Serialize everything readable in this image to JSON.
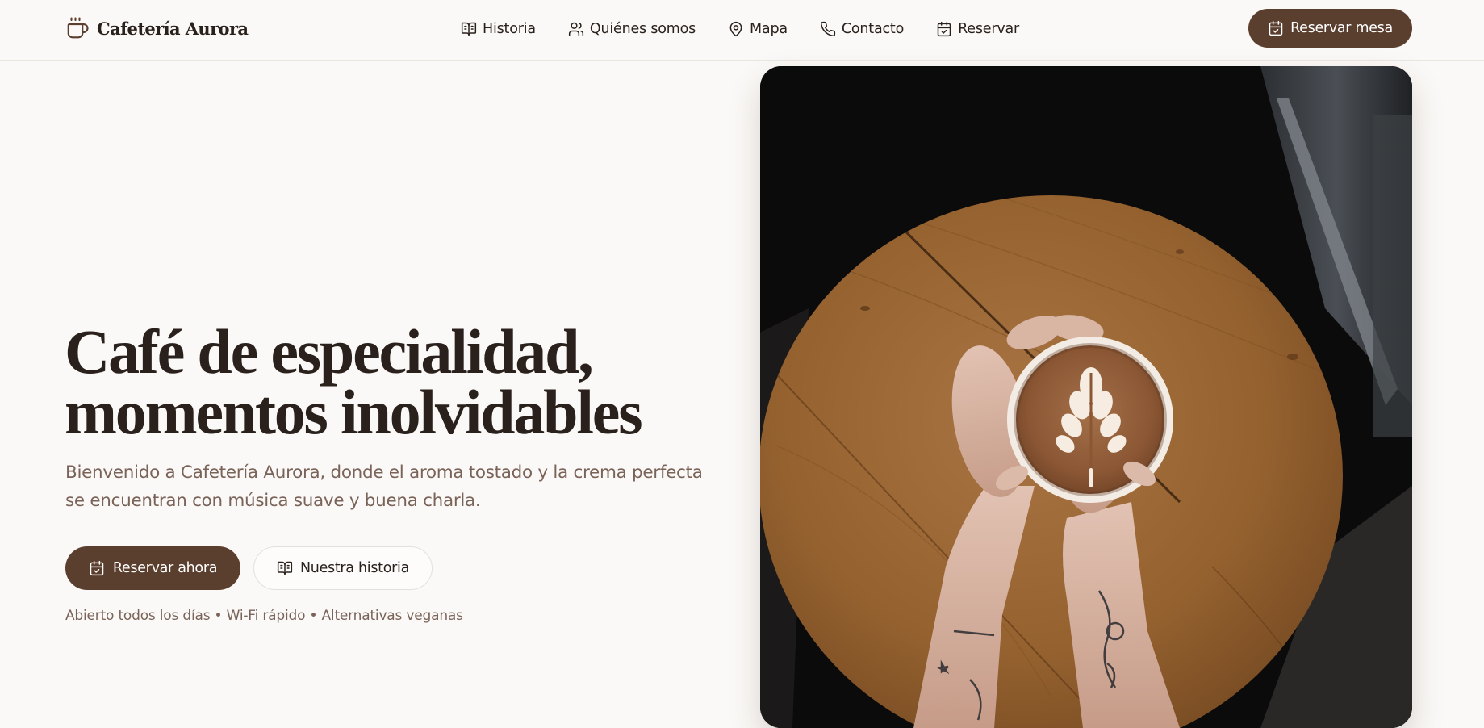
{
  "brand": {
    "name": "Cafetería Aurora",
    "logo_icon": "coffee-cup-icon"
  },
  "nav": {
    "items": [
      {
        "label": "Historia",
        "icon": "book-open-icon"
      },
      {
        "label": "Quiénes somos",
        "icon": "users-icon"
      },
      {
        "label": "Mapa",
        "icon": "map-pin-icon"
      },
      {
        "label": "Contacto",
        "icon": "phone-icon"
      },
      {
        "label": "Reservar",
        "icon": "calendar-check-icon"
      }
    ],
    "cta_label": "Reservar mesa",
    "cta_icon": "calendar-check-icon"
  },
  "hero": {
    "title_line1": "Café de especialidad,",
    "title_line2": "momentos inolvidables",
    "subtitle_line1": "Bienvenido a Cafetería Aurora, donde el aroma tostado y la crema perfecta",
    "subtitle_line2": "se encuentran con música suave y buena charla.",
    "primary_button": "Reservar ahora",
    "secondary_button": "Nuestra historia",
    "features": "Abierto todos los días • Wi-Fi rápido • Alternativas veganas"
  },
  "colors": {
    "background": "#fbf9f7",
    "brand_brown": "#5a3e2e",
    "text_dark": "#2a211c",
    "text_muted": "#7a6358",
    "border": "#ece6e1"
  }
}
